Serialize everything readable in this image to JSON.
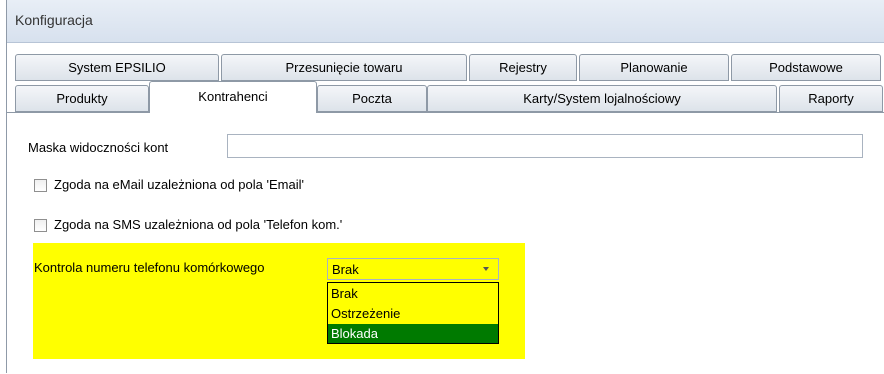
{
  "window": {
    "title": "Konfiguracja"
  },
  "tabs_row1": [
    {
      "label": "System EPSILIO"
    },
    {
      "label": "Przesunięcie towaru"
    },
    {
      "label": "Rejestry"
    },
    {
      "label": "Planowanie"
    },
    {
      "label": "Podstawowe"
    }
  ],
  "tabs_row2": [
    {
      "label": "Produkty"
    },
    {
      "label": "Kontrahenci",
      "active": true
    },
    {
      "label": "Poczta"
    },
    {
      "label": "Karty/System lojalnościowy"
    },
    {
      "label": "Raporty"
    }
  ],
  "form": {
    "maska_label": "Maska widoczności kont",
    "maska_value": "",
    "email_checkbox_label": "Zgoda na eMail uzależniona od pola 'Email'",
    "email_checked": false,
    "sms_checkbox_label": "Zgoda na SMS uzależniona od pola 'Telefon kom.'",
    "sms_checked": false,
    "phone_control_label": "Kontrola numeru telefonu komórkowego",
    "phone_control_value": "Brak",
    "phone_control_options": [
      "Brak",
      "Ostrzeżenie",
      "Blokada"
    ],
    "phone_control_highlighted_option": "Blokada"
  },
  "colors": {
    "highlight": "#ffff00",
    "selected_option_bg": "#007a00",
    "selected_option_text": "#ffffff"
  }
}
